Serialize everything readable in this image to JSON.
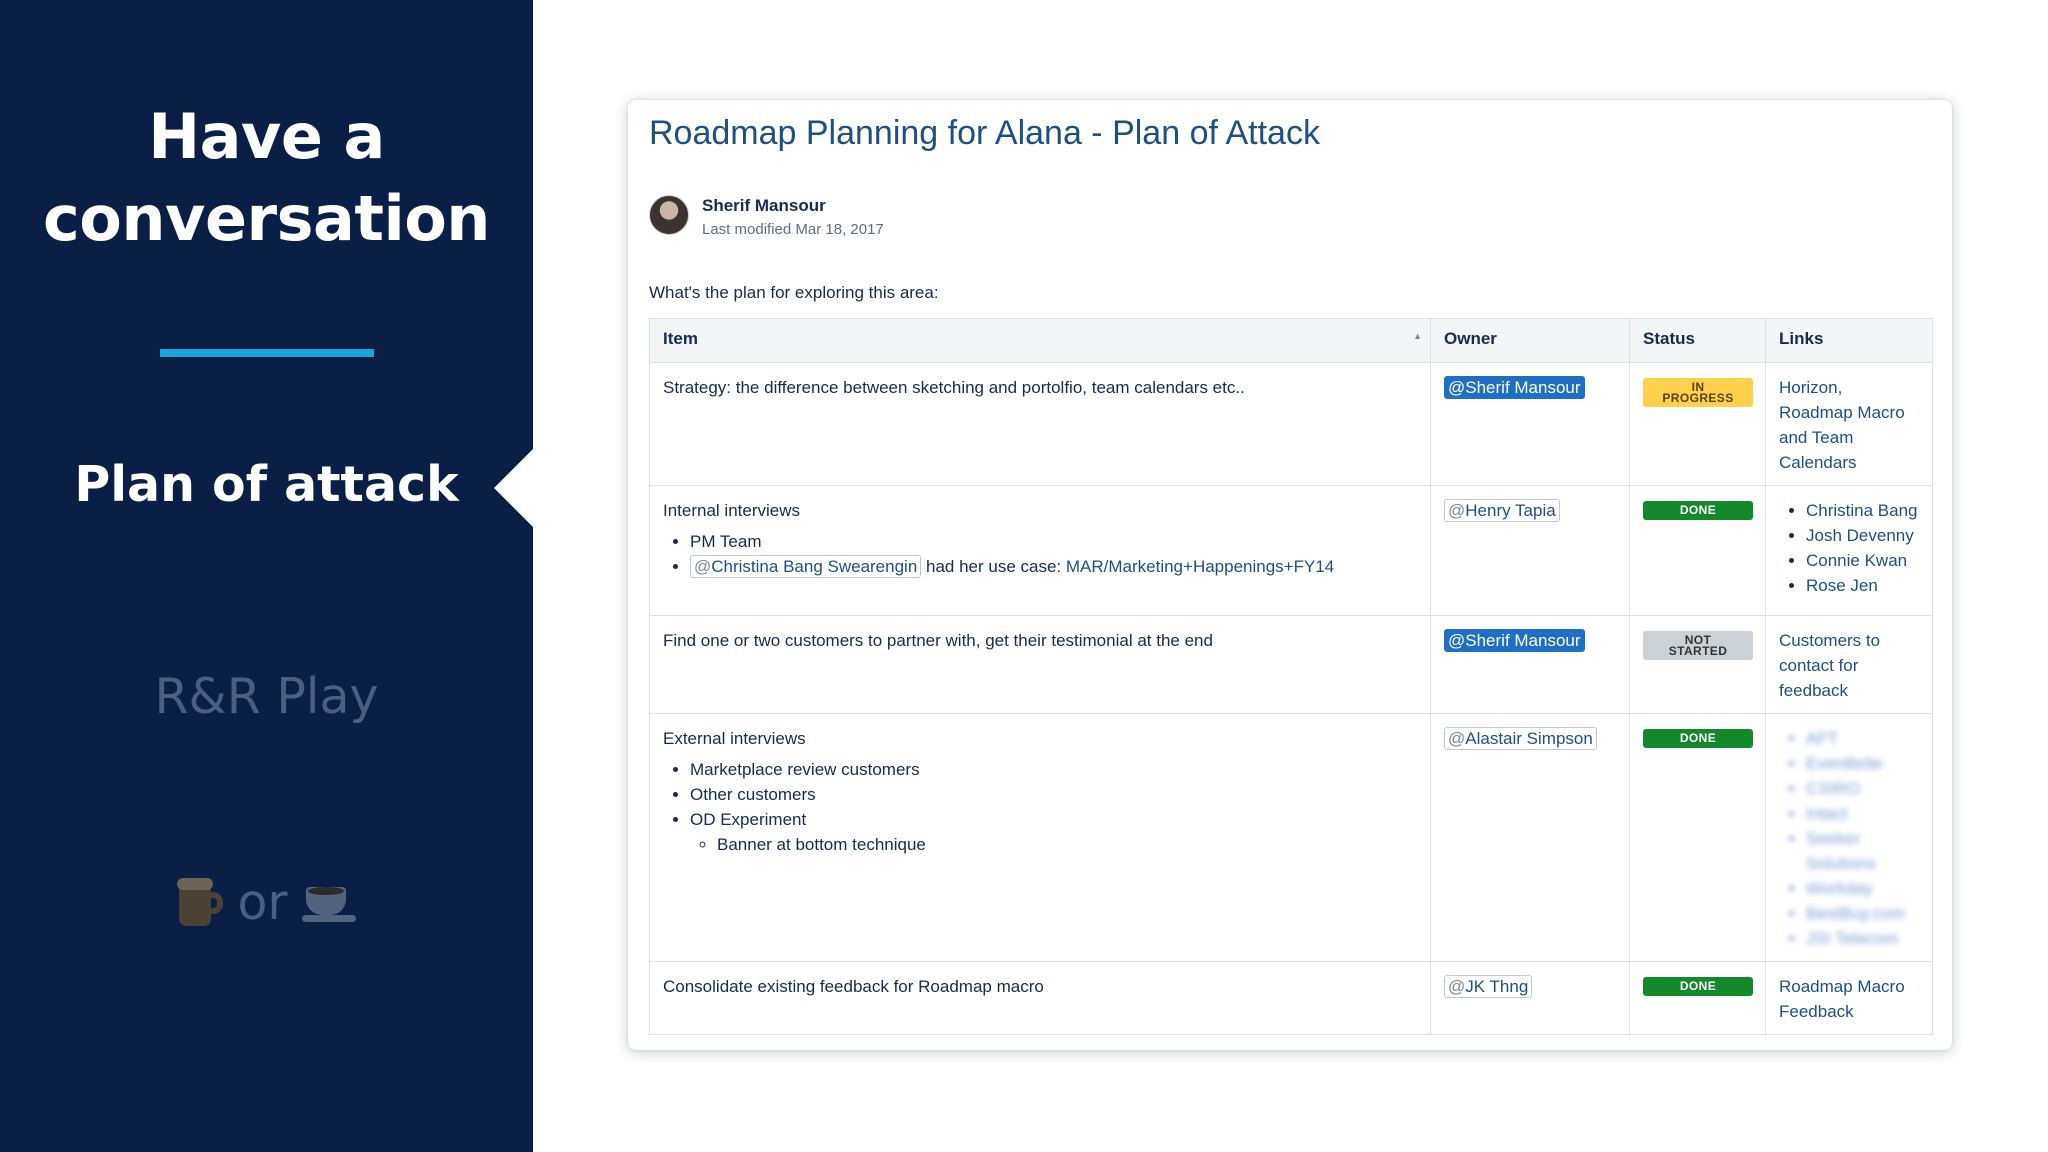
{
  "slide": {
    "title_line1": "Have a",
    "title_line2": "conversation",
    "agenda": {
      "active": "Plan of attack",
      "next": "R&R Play",
      "last_word": "or"
    },
    "icons": [
      "beer-mug-icon",
      "coffee-cup-icon"
    ],
    "colors": {
      "panel_bg": "#0b1f46",
      "accent": "#19a7d8",
      "dim_text": "#4c5f82"
    }
  },
  "page": {
    "title": "Roadmap Planning for Alana - Plan of Attack",
    "author": "Sherif Mansour",
    "modified": "Last modified Mar 18, 2017",
    "intro": "What's the plan for exploring this area:"
  },
  "table": {
    "headers": {
      "item": "Item",
      "owner": "Owner",
      "status": "Status",
      "links": "Links"
    },
    "rows": [
      {
        "item": "Strategy: the difference between sketching and portolfio, team calendars etc..",
        "owner": "Sherif Mansour",
        "status": "IN PROGRESS",
        "links_text": "Horizon, Roadmap Macro and Team Calendars"
      },
      {
        "item": "Internal interviews",
        "bullets": {
          "b1": "PM Team",
          "b2_mention": "Christina Bang Swearengin",
          "b2_text": " had her use case: ",
          "b2_link": "MAR/Marketing+Happenings+FY14"
        },
        "owner": "Henry Tapia",
        "status": "DONE",
        "links": [
          "Christina Bang",
          "Josh Devenny",
          "Connie Kwan",
          "Rose Jen"
        ]
      },
      {
        "item": "Find one or two customers to partner with, get their testimonial at the end",
        "owner": "Sherif Mansour",
        "status_line1": "NOT",
        "status_line2": "STARTED",
        "links_text": "Customers to contact for feedback"
      },
      {
        "item": "External interviews",
        "bullets": {
          "b1": "Marketplace review customers",
          "b2": "Other customers",
          "b3": "OD Experiment",
          "b3_sub": "Banner at bottom technique"
        },
        "owner": "Alastair Simpson",
        "status": "DONE",
        "links_blurred": [
          "AFT",
          "Eventbrite",
          "CSIRO",
          "Intact",
          "Seeker Solutions",
          "Workday",
          "BestBuy.com",
          "JSI Telecom"
        ]
      },
      {
        "item": "Consolidate existing feedback for Roadmap macro",
        "owner": "JK Thng",
        "status": "DONE",
        "links_text": "Roadmap Macro Feedback"
      }
    ]
  },
  "status_prefix_1": "IN",
  "status_prefix_2": "PROGRESS",
  "mention_prefix": "@"
}
